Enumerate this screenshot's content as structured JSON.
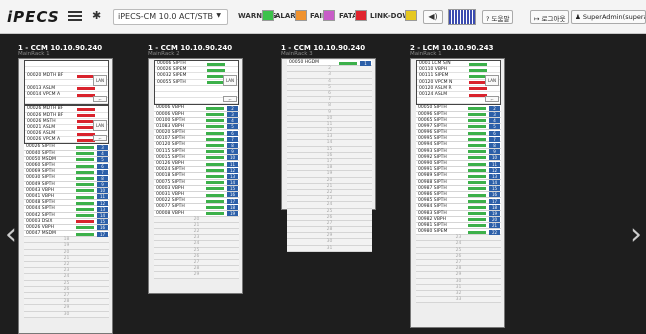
{
  "header": {
    "logo": "iPECS",
    "system_select": "iPECS-CM 10.0 ACT/STB",
    "statuses": [
      {
        "label": "WARNING",
        "color": "#3cc24a"
      },
      {
        "label": "ALARM",
        "color": "#f0922e"
      },
      {
        "label": "FAIL",
        "color": "#c85cc8"
      },
      {
        "label": "FATAL",
        "color": "#e0242e"
      },
      {
        "label": "LINK-DOWN",
        "color": "#e6c820"
      }
    ],
    "sound_icon": "speaker-icon",
    "help_label": "도움말",
    "logout_label": "로그아웃",
    "user_label": "SuperAdmin(superadmin)"
  },
  "racks": [
    {
      "title": "1 - CCM 10.10.90.240",
      "subtitle": "MainRack 1",
      "modules": [
        {
          "header": "1",
          "rows": [
            {
              "label": "",
              "bar": "none"
            },
            {
              "label": "",
              "bar": "none"
            },
            {
              "label": "00020  MDTH BF",
              "bar": "red"
            },
            {
              "label": "",
              "bar": "none"
            },
            {
              "label": "00013  ASLM",
              "bar": "red"
            },
            {
              "label": "00014  VPCM A",
              "bar": "red"
            },
            {
              "label": "",
              "bar": "none"
            }
          ]
        },
        {
          "header": "2",
          "rows": [
            {
              "label": "00026  MDTH BF",
              "bar": "red"
            },
            {
              "label": "00026  MDTH BF",
              "bar": "red"
            },
            {
              "label": "00026  MSTH",
              "bar": "red"
            },
            {
              "label": "00021  ASLM",
              "bar": "red"
            },
            {
              "label": "00026  ASLM",
              "bar": "red"
            },
            {
              "label": "00026  VPCM A",
              "bar": "red"
            }
          ]
        }
      ],
      "slots": [
        {
          "label": "00026  SIPTH",
          "bar": "green",
          "num": "3"
        },
        {
          "label": "00040  SIPTH",
          "bar": "green",
          "num": "4"
        },
        {
          "label": "00050  MSDM",
          "bar": "green",
          "num": "5"
        },
        {
          "label": "00060  SIPTH",
          "bar": "green",
          "num": "6"
        },
        {
          "label": "00069  SIPTH",
          "bar": "green",
          "num": "7"
        },
        {
          "label": "00030  SIPTH",
          "bar": "green",
          "num": "8"
        },
        {
          "label": "00049  SIPTH",
          "bar": "green",
          "num": "9"
        },
        {
          "label": "00043  VBPH",
          "bar": "green",
          "num": "10"
        },
        {
          "label": "00041  VBPH",
          "bar": "green",
          "num": "11"
        },
        {
          "label": "00048  SIPTH",
          "bar": "green",
          "num": "12"
        },
        {
          "label": "00044  SIPTH",
          "bar": "green",
          "num": "13"
        },
        {
          "label": "00042  SIPTH",
          "bar": "green",
          "num": "14"
        },
        {
          "label": "00003  DSIX",
          "bar": "red",
          "num": "15"
        },
        {
          "label": "00026  VBPH",
          "bar": "green",
          "num": "16"
        },
        {
          "label": "00047  MSDM",
          "bar": "green",
          "num": "17"
        }
      ],
      "empty": [
        "18",
        "19",
        "20",
        "21",
        "22",
        "23",
        "24",
        "25",
        "26",
        "27",
        "28",
        "29",
        "30"
      ]
    },
    {
      "title": "1 - CCM 10.10.90.240",
      "subtitle": "MainRack 2",
      "modules": [
        {
          "header": "1",
          "rows": [
            {
              "label": "00006  SIPTH",
              "bar": "green"
            },
            {
              "label": "00026  SIPEM",
              "bar": "green"
            },
            {
              "label": "00032  SIPEM",
              "bar": "green"
            },
            {
              "label": "00055  SIPTH",
              "bar": "green"
            },
            {
              "label": "",
              "bar": "none"
            },
            {
              "label": "",
              "bar": "none"
            },
            {
              "label": "",
              "bar": "none"
            }
          ]
        }
      ],
      "slots": [
        {
          "label": "00006  VBPH",
          "bar": "green",
          "num": "2"
        },
        {
          "label": "00006  VBPH",
          "bar": "green",
          "num": "3"
        },
        {
          "label": "00100  SIPTH",
          "bar": "green",
          "num": "4"
        },
        {
          "label": "01083  VBPH",
          "bar": "green",
          "num": "5"
        },
        {
          "label": "00020  SIPTH",
          "bar": "green",
          "num": "6"
        },
        {
          "label": "00107  SIPTH",
          "bar": "green",
          "num": "7"
        },
        {
          "label": "00120  SIPTH",
          "bar": "green",
          "num": "8"
        },
        {
          "label": "00115  SIPTH",
          "bar": "green",
          "num": "9"
        },
        {
          "label": "00015  SIPTH",
          "bar": "green",
          "num": "10"
        },
        {
          "label": "00126  VBPH",
          "bar": "green",
          "num": "11"
        },
        {
          "label": "00024  SIPTH",
          "bar": "green",
          "num": "12"
        },
        {
          "label": "00018  SIPTH",
          "bar": "green",
          "num": "13"
        },
        {
          "label": "00075  SIPTH",
          "bar": "green",
          "num": "14"
        },
        {
          "label": "00003  VBPH",
          "bar": "green",
          "num": "15"
        },
        {
          "label": "00031  VBPH",
          "bar": "green",
          "num": "16"
        },
        {
          "label": "00022  SIPTH",
          "bar": "green",
          "num": "17"
        },
        {
          "label": "00077  SIPTH",
          "bar": "green",
          "num": "18"
        },
        {
          "label": "00008  VBPH",
          "bar": "green",
          "num": "19"
        }
      ],
      "empty": [
        "20",
        "21",
        "22",
        "23",
        "24",
        "25",
        "26",
        "27",
        "28",
        "29"
      ]
    },
    {
      "title": "1 - CCM 10.10.90.240",
      "subtitle": "MainRack 3",
      "modules": [],
      "slots": [
        {
          "label": "00050  HGDM",
          "bar": "green",
          "num": "1"
        }
      ],
      "empty": [
        "2",
        "3",
        "4",
        "5",
        "6",
        "7",
        "8",
        "9",
        "10",
        "11",
        "12",
        "13",
        "14",
        "15",
        "16",
        "17",
        "18",
        "19",
        "20",
        "21",
        "22",
        "23",
        "24",
        "25",
        "26",
        "27",
        "28",
        "29",
        "30",
        "31"
      ]
    },
    {
      "title": "2 - LCM 10.10.90.243",
      "subtitle": "MainRack 1",
      "modules": [
        {
          "header": "1",
          "rows": [
            {
              "label": "0001  LCM S/N",
              "bar": "green"
            },
            {
              "label": "00110  VBPH",
              "bar": "green"
            },
            {
              "label": "00111  SIPEM",
              "bar": "green"
            },
            {
              "label": "00120  VPCM N",
              "bar": "red"
            },
            {
              "label": "00120  ASLM R",
              "bar": "red"
            },
            {
              "label": "00124  ASLM",
              "bar": "red"
            },
            {
              "label": "",
              "bar": "none"
            }
          ]
        }
      ],
      "slots": [
        {
          "label": "00050  SIPTH",
          "bar": "green",
          "num": "2"
        },
        {
          "label": "00096  SIPTH",
          "bar": "green",
          "num": "3"
        },
        {
          "label": "00065  SIPTH",
          "bar": "green",
          "num": "4"
        },
        {
          "label": "00997  SIPTH",
          "bar": "green",
          "num": "5"
        },
        {
          "label": "00996  SIPTH",
          "bar": "green",
          "num": "6"
        },
        {
          "label": "00995  SIPTH",
          "bar": "green",
          "num": "7"
        },
        {
          "label": "00994  SIPTH",
          "bar": "green",
          "num": "8"
        },
        {
          "label": "00993  SIPTH",
          "bar": "green",
          "num": "9"
        },
        {
          "label": "00992  SIPTH",
          "bar": "green",
          "num": "10"
        },
        {
          "label": "00990  SIPTH",
          "bar": "green",
          "num": "11"
        },
        {
          "label": "00991  SIPTH",
          "bar": "green",
          "num": "12"
        },
        {
          "label": "00989  SIPTH",
          "bar": "green",
          "num": "13"
        },
        {
          "label": "00988  SIPTH",
          "bar": "green",
          "num": "14"
        },
        {
          "label": "00987  SIPTH",
          "bar": "green",
          "num": "15"
        },
        {
          "label": "00986  SIPTH",
          "bar": "green",
          "num": "16"
        },
        {
          "label": "00985  SIPTH",
          "bar": "green",
          "num": "17"
        },
        {
          "label": "00984  SIPTH",
          "bar": "green",
          "num": "18"
        },
        {
          "label": "00983  SIPTH",
          "bar": "green",
          "num": "19"
        },
        {
          "label": "00982  VBPH",
          "bar": "green",
          "num": "20"
        },
        {
          "label": "00981  SIPTH",
          "bar": "green",
          "num": "21"
        },
        {
          "label": "00980  SIPEM",
          "bar": "green",
          "num": "22"
        }
      ],
      "empty": [
        "23",
        "24",
        "25",
        "26",
        "27",
        "28",
        "29",
        "30",
        "31",
        "32",
        "33"
      ]
    }
  ],
  "nav": {
    "prev": "‹",
    "next": "›"
  }
}
